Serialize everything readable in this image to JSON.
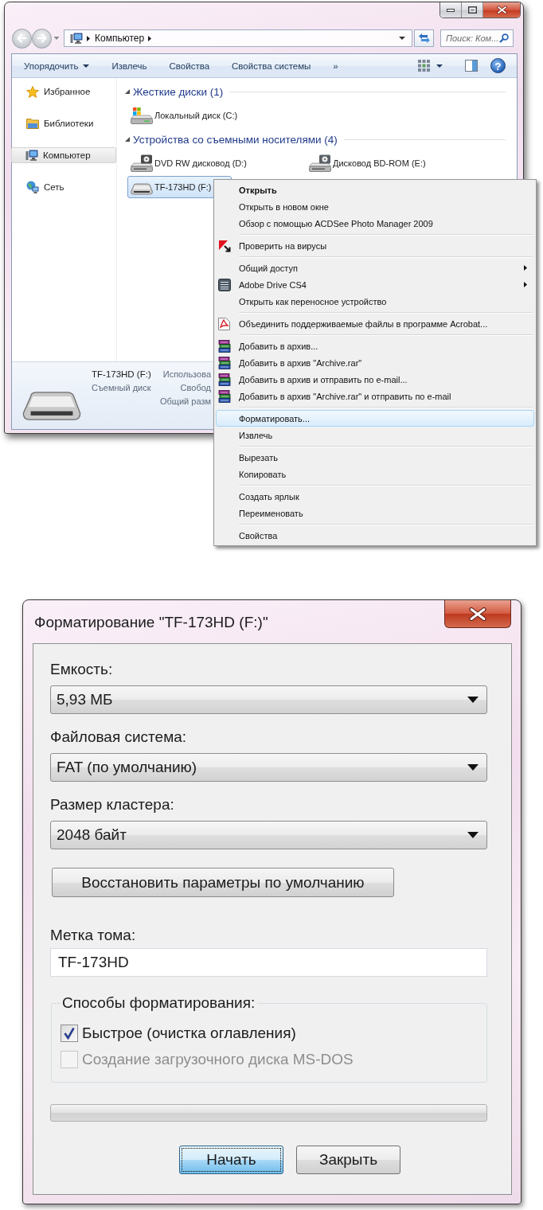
{
  "explorer": {
    "address_bar": {
      "location": "Компьютер"
    },
    "search": {
      "placeholder": "Поиск: Ком..."
    },
    "toolbar": {
      "items": [
        {
          "label": "Упорядочить",
          "kind": "menu"
        },
        {
          "label": "Извлечь",
          "kind": "button"
        },
        {
          "label": "Свойства",
          "kind": "button"
        },
        {
          "label": "Свойства системы",
          "kind": "button"
        },
        {
          "label": "»",
          "kind": "overflow"
        }
      ],
      "help": "?"
    },
    "navigation": [
      {
        "label": "Избранное",
        "kind": "favorites",
        "selected": false
      },
      {
        "label": "Библиотеки",
        "kind": "libraries",
        "selected": false
      },
      {
        "label": "Компьютер",
        "kind": "computer",
        "selected": true
      },
      {
        "label": "Сеть",
        "kind": "network",
        "selected": false
      }
    ],
    "groups": [
      {
        "title": "Жесткие диски (1)",
        "expanded": true,
        "items": [
          {
            "label": "Локальный диск (C:)",
            "kind": "system-disk",
            "selected": false
          }
        ]
      },
      {
        "title": "Устройства со съемными носителями (4)",
        "expanded": true,
        "items": [
          {
            "label": "DVD RW дисковод (D:)",
            "kind": "dvd-drive",
            "selected": false
          },
          {
            "label": "Дисковод BD-ROM (E:)",
            "kind": "bd-drive",
            "selected": false
          },
          {
            "label": "TF-173HD (F:)",
            "kind": "removable-disk",
            "selected": true
          }
        ]
      }
    ],
    "details": {
      "name": "TF-173HD (F:)",
      "type": "Съемный диск",
      "properties": [
        "Использова",
        "Свобод",
        "Общий разм"
      ]
    }
  },
  "context_menu": {
    "sections": [
      {
        "items": [
          {
            "label": "Открыть",
            "kind": "plain",
            "default": true,
            "submenu": false,
            "selected": false
          },
          {
            "label": "Открыть в новом окне",
            "kind": "plain",
            "default": false,
            "submenu": false,
            "selected": false
          },
          {
            "label": "Обзор с помощью ACDSee Photo Manager 2009",
            "kind": "plain",
            "default": false,
            "submenu": false,
            "selected": false
          }
        ]
      },
      {
        "items": [
          {
            "label": "Проверить на вирусы",
            "kind": "antivirus",
            "default": false,
            "submenu": false,
            "selected": false
          }
        ]
      },
      {
        "items": [
          {
            "label": "Общий доступ",
            "kind": "plain",
            "default": false,
            "submenu": true,
            "selected": false
          },
          {
            "label": "Adobe Drive CS4",
            "kind": "adobe-drive",
            "default": false,
            "submenu": true,
            "selected": false
          },
          {
            "label": "Открыть как переносное устройство",
            "kind": "plain",
            "default": false,
            "submenu": false,
            "selected": false
          }
        ]
      },
      {
        "items": [
          {
            "label": "Объединить поддерживаемые файлы в программе Acrobat...",
            "kind": "acrobat",
            "default": false,
            "submenu": false,
            "selected": false
          }
        ]
      },
      {
        "items": [
          {
            "label": "Добавить в архив...",
            "kind": "archive",
            "default": false,
            "submenu": false,
            "selected": false
          },
          {
            "label": "Добавить в архив \"Archive.rar\"",
            "kind": "archive",
            "default": false,
            "submenu": false,
            "selected": false
          },
          {
            "label": "Добавить в архив и отправить по e-mail...",
            "kind": "archive",
            "default": false,
            "submenu": false,
            "selected": false
          },
          {
            "label": "Добавить в архив \"Archive.rar\" и отправить по e-mail",
            "kind": "archive",
            "default": false,
            "submenu": false,
            "selected": false
          }
        ]
      },
      {
        "items": [
          {
            "label": "Форматировать...",
            "kind": "plain",
            "default": false,
            "submenu": false,
            "selected": true
          },
          {
            "label": "Извлечь",
            "kind": "plain",
            "default": false,
            "submenu": false,
            "selected": false
          }
        ]
      },
      {
        "items": [
          {
            "label": "Вырезать",
            "kind": "plain",
            "default": false,
            "submenu": false,
            "selected": false
          },
          {
            "label": "Копировать",
            "kind": "plain",
            "default": false,
            "submenu": false,
            "selected": false
          }
        ]
      },
      {
        "items": [
          {
            "label": "Создать ярлык",
            "kind": "plain",
            "default": false,
            "submenu": false,
            "selected": false
          },
          {
            "label": "Переименовать",
            "kind": "plain",
            "default": false,
            "submenu": false,
            "selected": false
          }
        ]
      },
      {
        "items": [
          {
            "label": "Свойства",
            "kind": "plain",
            "default": false,
            "submenu": false,
            "selected": false
          }
        ]
      }
    ]
  },
  "format_dialog": {
    "title": "Форматирование \"TF-173HD (F:)\"",
    "selects": [
      {
        "label": "Емкость:",
        "value": "5,93 МБ"
      },
      {
        "label": "Файловая система:",
        "value": "FAT (по умолчанию)"
      },
      {
        "label": "Размер кластера:",
        "value": "2048 байт"
      }
    ],
    "restore_button": "Восстановить параметры по умолчанию",
    "volume_label": {
      "label": "Метка тома:",
      "value": "TF-173HD"
    },
    "options": {
      "title": "Способы форматирования:",
      "items": [
        {
          "label": "Быстрое (очистка оглавления)",
          "checked": true,
          "disabled": false
        },
        {
          "label": "Создание загрузочного диска MS-DOS",
          "checked": false,
          "disabled": true
        }
      ]
    },
    "progress": {
      "level": 0
    },
    "buttons": [
      {
        "label": "Начать",
        "default": true
      },
      {
        "label": "Закрыть",
        "default": false
      }
    ]
  }
}
